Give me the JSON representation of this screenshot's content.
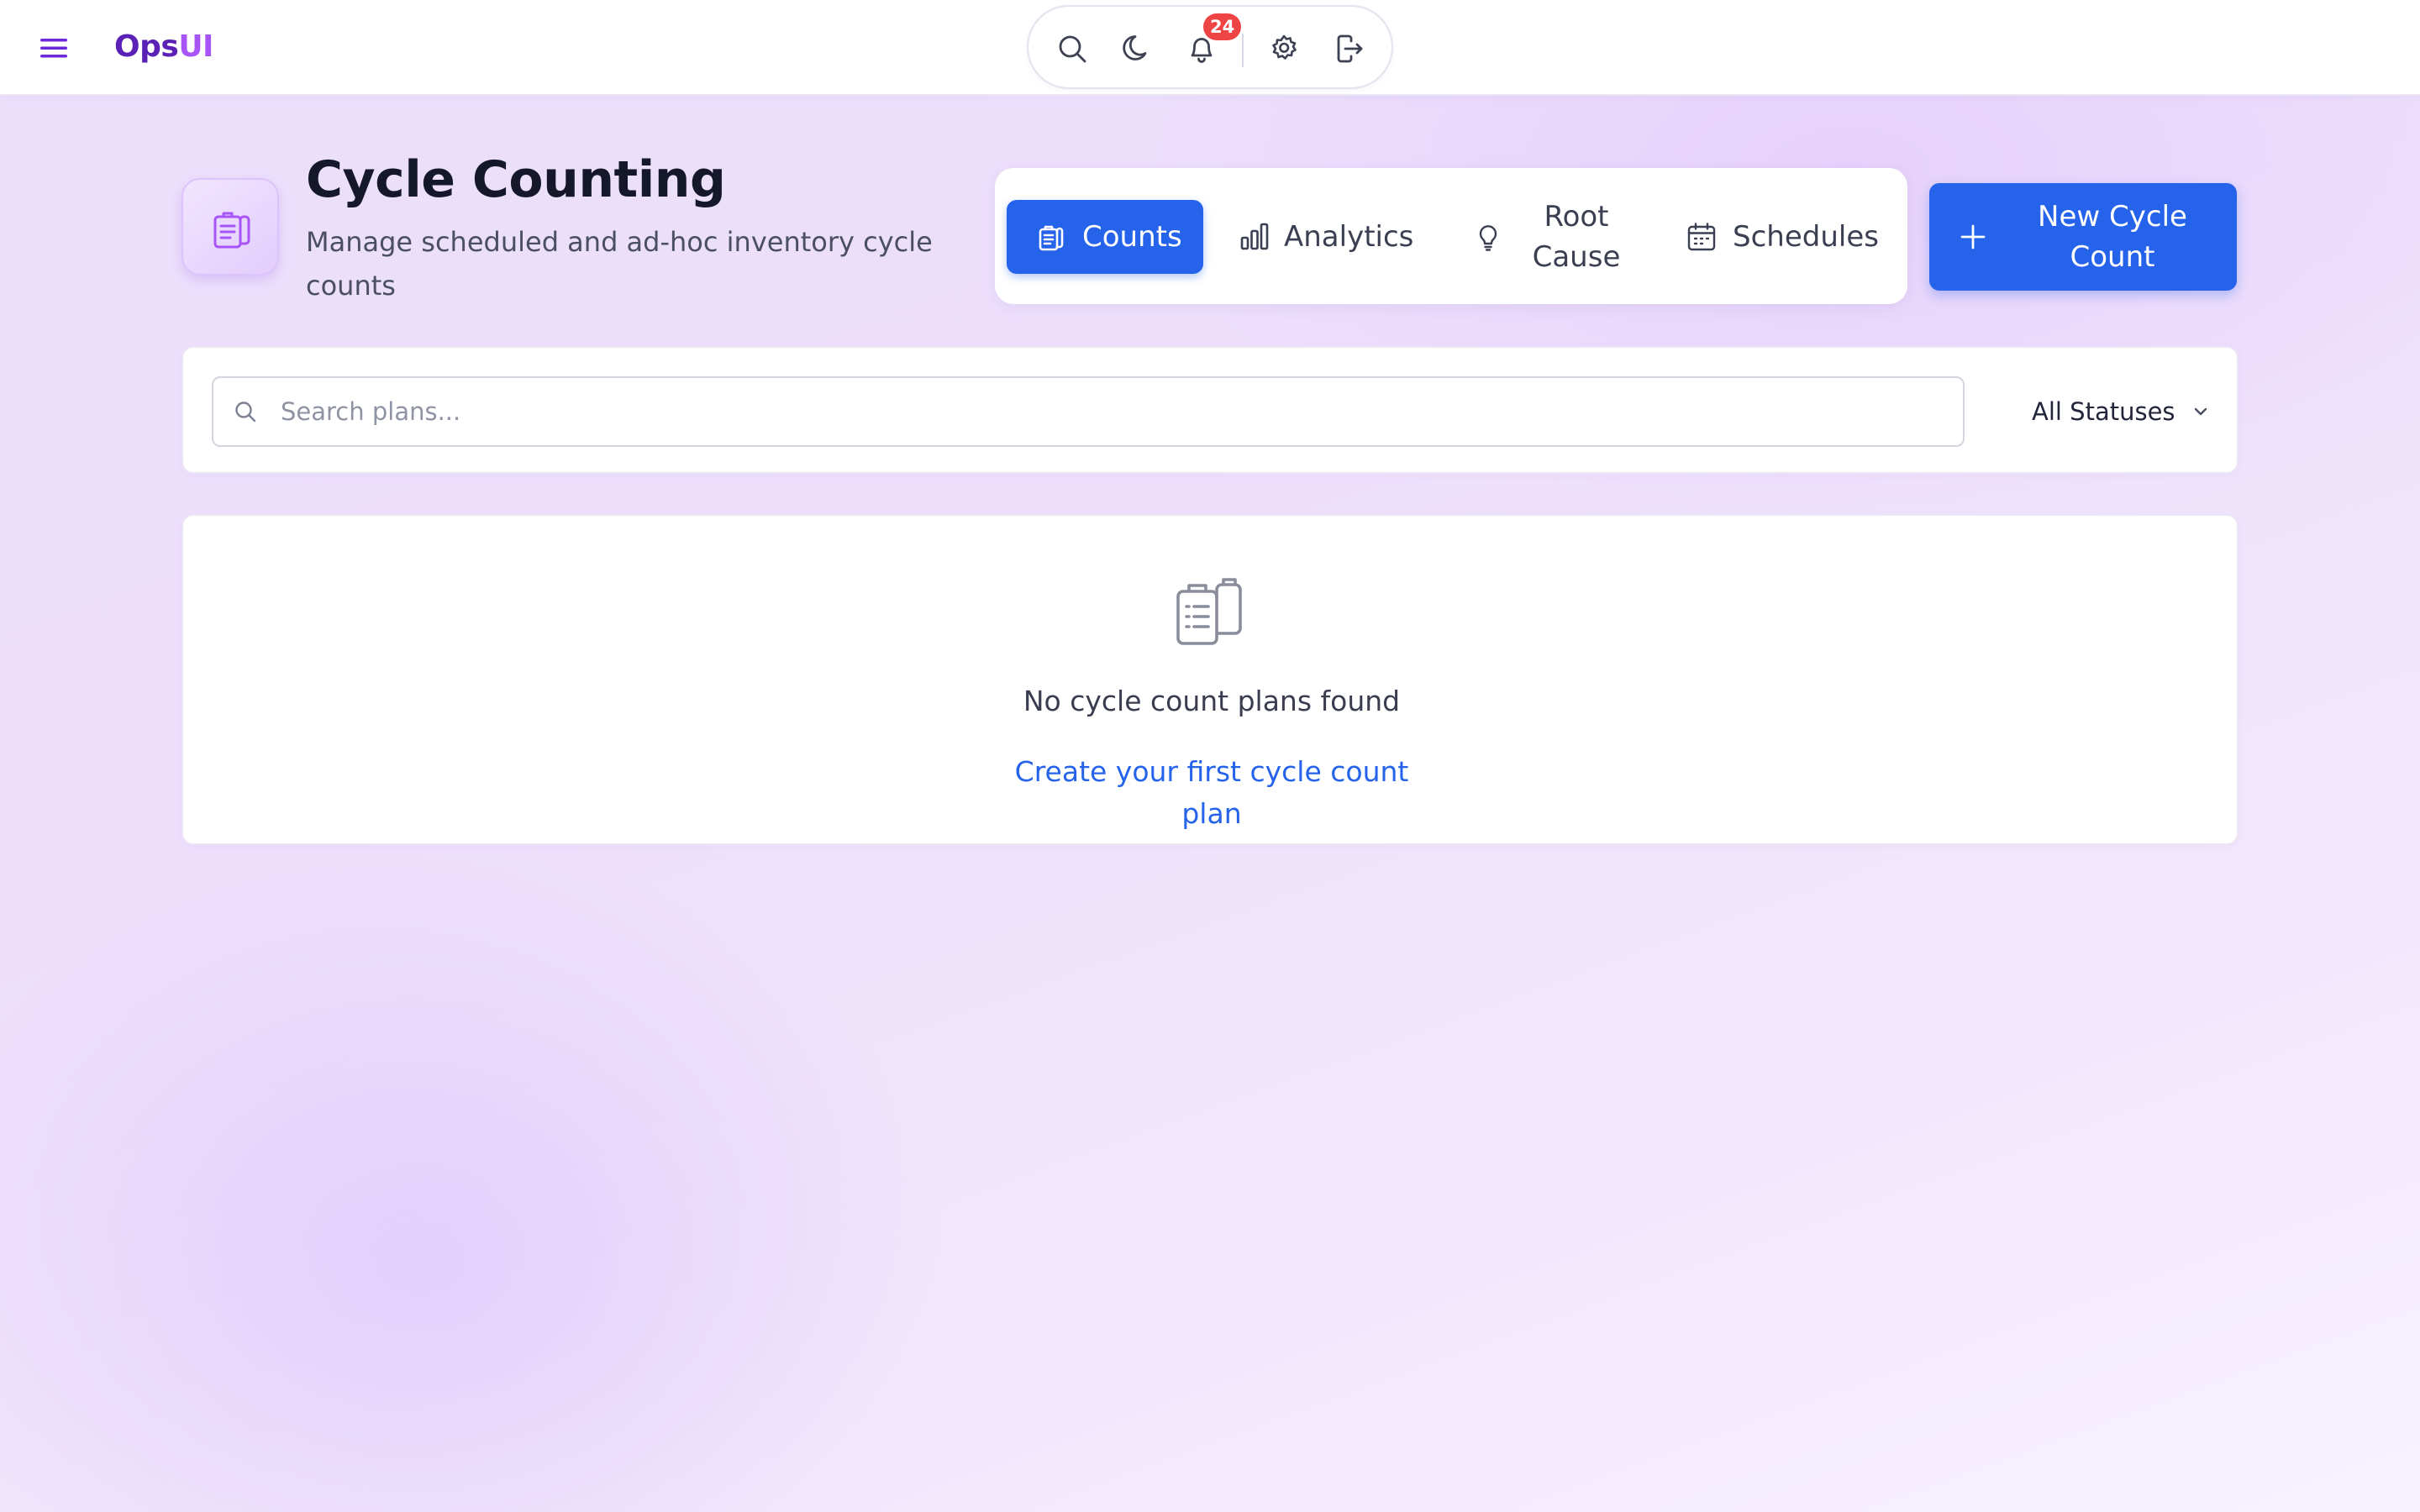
{
  "brand": {
    "part1": "Ops",
    "part2": "UI"
  },
  "toolbar": {
    "notifications_count": "24",
    "icons": [
      "search-icon",
      "moon-icon",
      "bell-icon",
      "gear-icon",
      "logout-icon"
    ]
  },
  "page": {
    "title": "Cycle Counting",
    "subtitle": "Manage scheduled and ad-hoc inventory cycle counts",
    "icon": "clipboard-icon"
  },
  "tabs": [
    {
      "label": "Counts",
      "icon": "clipboard-icon",
      "active": true
    },
    {
      "label": "Analytics",
      "icon": "bar-chart-icon",
      "active": false
    },
    {
      "label": "Root Cause",
      "icon": "lightbulb-icon",
      "active": false
    },
    {
      "label": "Schedules",
      "icon": "calendar-icon",
      "active": false
    }
  ],
  "actions": {
    "new_label": "New Cycle Count"
  },
  "filters": {
    "search_placeholder": "Search plans...",
    "status_selected": "All Statuses"
  },
  "empty_state": {
    "message": "No cycle count plans found",
    "link_label": "Create your first cycle count plan"
  },
  "colors": {
    "accent": "#2563eb",
    "brand_dark": "#5b21b6",
    "brand_light": "#a855f7",
    "badge": "#ef4444",
    "background": "#ecdffc"
  }
}
